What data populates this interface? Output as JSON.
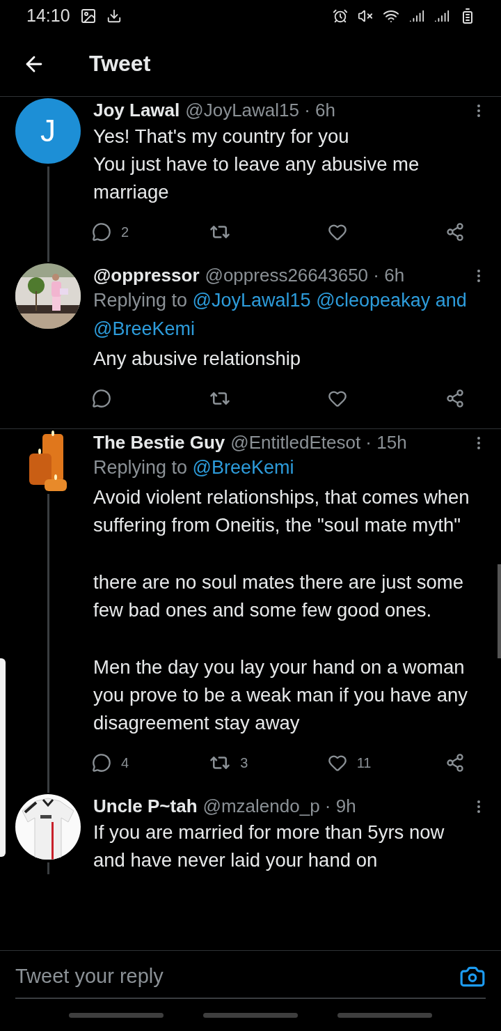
{
  "status_bar": {
    "time": "14:10"
  },
  "header": {
    "title": "Tweet"
  },
  "tweets": [
    {
      "name": "Joy Lawal",
      "meta": "@JoyLawal15 · 6h",
      "avatar": {
        "kind": "letter",
        "letter": "J"
      },
      "thread_line": true,
      "divider_below": false,
      "body": [
        "Yes! That's my country for you\nYou just have to leave any abusive me marriage"
      ],
      "actions": [
        {
          "kind": "reply",
          "count": "2"
        },
        {
          "kind": "retweet"
        },
        {
          "kind": "like"
        },
        {
          "kind": "share"
        }
      ]
    },
    {
      "name": "@oppressor",
      "meta": "@oppress26643650 · 6h",
      "avatar": {
        "kind": "picture"
      },
      "thread_line": false,
      "divider_below": true,
      "replying": {
        "label": "Replying to",
        "targets": [
          "@JoyLawal15",
          "@cleopeakay",
          "and",
          "@BreeKemi"
        ]
      },
      "body": [
        "Any abusive relationship"
      ],
      "actions": [
        {
          "kind": "reply"
        },
        {
          "kind": "retweet"
        },
        {
          "kind": "like"
        },
        {
          "kind": "share"
        }
      ]
    },
    {
      "name": "The Bestie Guy",
      "meta": "@EntitledEtesot · 15h",
      "avatar": {
        "kind": "picture"
      },
      "thread_line": true,
      "divider_below": false,
      "replying": {
        "label": "Replying to",
        "targets": [
          "@BreeKemi"
        ]
      },
      "body": [
        "Avoid violent relationships, that comes when suffering from Oneitis, the \"soul mate myth\"",
        "there are no soul mates there are just some few bad ones and some few good ones.",
        "Men the day you lay your hand on a woman you prove to be a weak man if you have any disagreement stay away"
      ],
      "actions": [
        {
          "kind": "reply",
          "count": "4"
        },
        {
          "kind": "retweet",
          "count": "3"
        },
        {
          "kind": "like",
          "count": "11"
        },
        {
          "kind": "share"
        }
      ]
    },
    {
      "name": "Uncle P~tah",
      "meta": "@mzalendo_p · 9h",
      "avatar": {
        "kind": "picture"
      },
      "thread_line": true,
      "divider_below": false,
      "body": [
        "If you are married for more than 5yrs now and have never laid your hand on"
      ]
    }
  ],
  "reply_bar": {
    "placeholder": "Tweet your reply"
  }
}
